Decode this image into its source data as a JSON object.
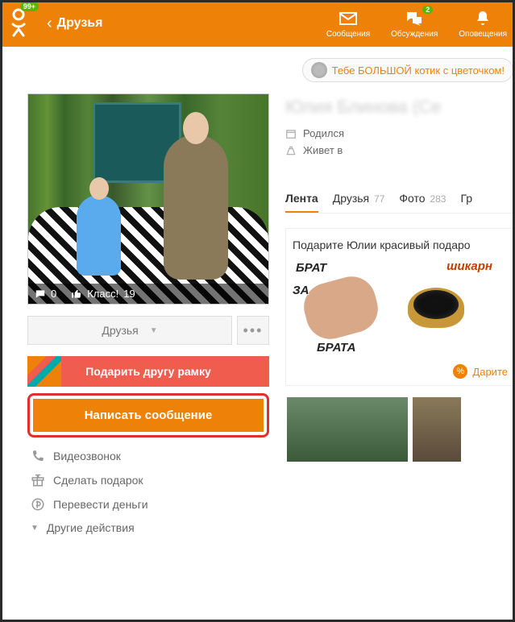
{
  "header": {
    "badge": "99+",
    "back_title": "Друзья",
    "messages_label": "Сообщения",
    "discussions_label": "Обсуждения",
    "discussions_badge": "2",
    "notifications_label": "Оповещения"
  },
  "promo": {
    "text": "Тебе БОЛЬШОЙ котик с цветочком!"
  },
  "photo_bar": {
    "comments": "0",
    "like_label": "Класс!",
    "like_count": "19"
  },
  "left": {
    "friends_dd": "Друзья",
    "gift_frame": "Подарить другу рамку",
    "write_msg": "Написать сообщение",
    "actions": {
      "videocall": "Видеозвонок",
      "gift": "Сделать подарок",
      "money": "Перевести деньги",
      "more": "Другие действия"
    }
  },
  "profile": {
    "name_blur": "Юлия Блинова (Се",
    "born_label": "Родился",
    "lives_label": "Живет в"
  },
  "tabs": {
    "feed": "Лента",
    "friends": "Друзья",
    "friends_cnt": "77",
    "photo": "Фото",
    "photo_cnt": "283",
    "groups": "Гр"
  },
  "gift_block": {
    "title": "Подарите Юлии красивый подаро",
    "stk1_a": "БРАТ",
    "stk1_b": "ЗА",
    "stk1_c": "БРАТА",
    "stk2": "шикарн",
    "footer": "Дарите"
  }
}
